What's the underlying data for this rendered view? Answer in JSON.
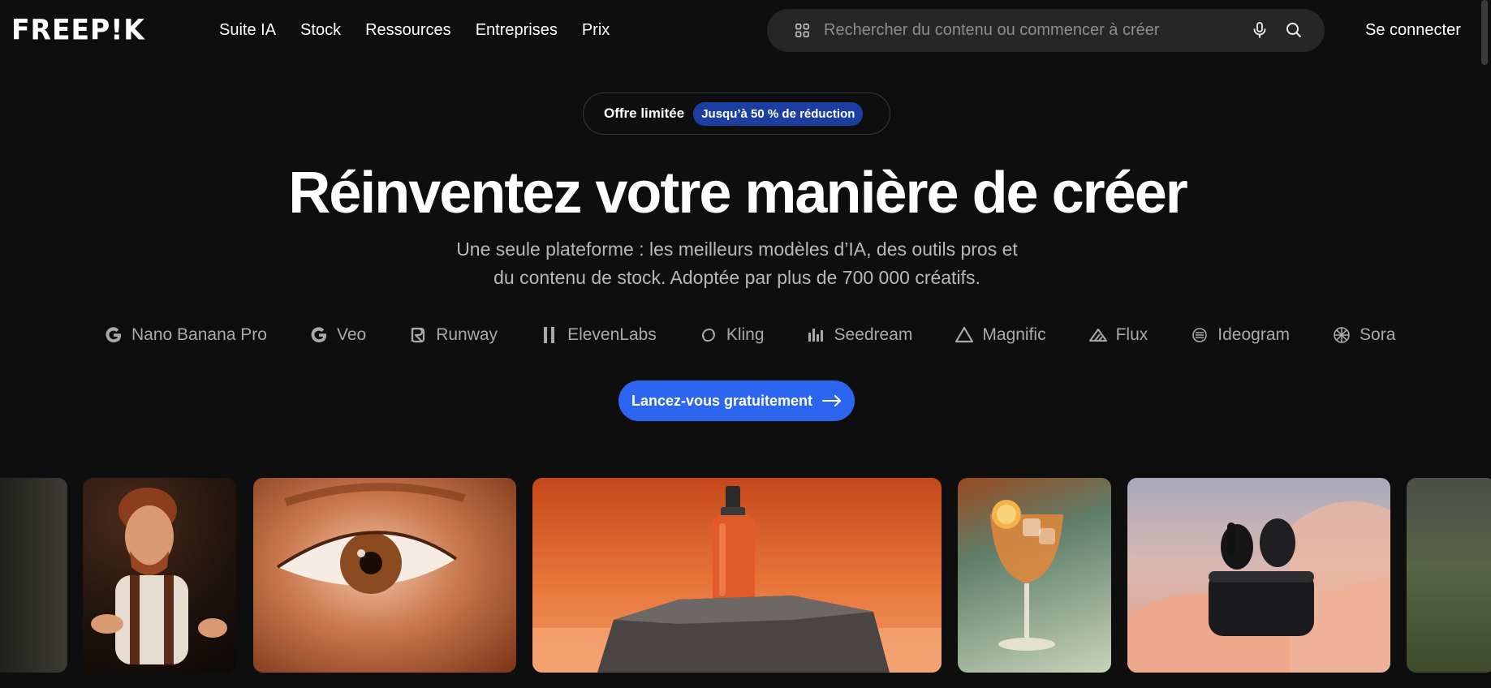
{
  "header": {
    "logo": "FREEP!K",
    "nav": [
      "Suite IA",
      "Stock",
      "Ressources",
      "Entreprises",
      "Prix"
    ],
    "search_placeholder": "Rechercher du contenu ou commencer à créer",
    "login": "Se connecter"
  },
  "offer": {
    "label": "Offre limitée",
    "badge": "Jusqu’à 50 % de réduction"
  },
  "hero": {
    "title": "Réinventez votre manière de créer",
    "subtitle_line1": "Une seule plateforme : les meilleurs modèles d’IA, des outils pros et",
    "subtitle_line2": "du contenu de stock. Adoptée par plus de 700 000 créatifs."
  },
  "models": [
    {
      "name": "Nano Banana Pro",
      "icon": "google-g-icon"
    },
    {
      "name": "Veo",
      "icon": "google-g-icon"
    },
    {
      "name": "Runway",
      "icon": "runway-icon"
    },
    {
      "name": "ElevenLabs",
      "icon": "elevenlabs-icon"
    },
    {
      "name": "Kling",
      "icon": "kling-icon"
    },
    {
      "name": "Seedream",
      "icon": "seedream-icon"
    },
    {
      "name": "Magnific",
      "icon": "magnific-icon"
    },
    {
      "name": "Flux",
      "icon": "flux-icon"
    },
    {
      "name": "Ideogram",
      "icon": "ideogram-icon"
    },
    {
      "name": "Sora",
      "icon": "sora-icon"
    }
  ],
  "cta": {
    "label": "Lancez-vous gratuitement"
  },
  "gallery": [
    "partial-dark-image",
    "cartoon-character",
    "eye-closeup",
    "orange-bottle-on-rock",
    "cocktail-glass",
    "black-earbuds-case",
    "partial-field-image"
  ],
  "colors": {
    "background": "#0e0e0e",
    "accent": "#2c66f0",
    "badge": "#1c3ea0",
    "search_bg": "#262626"
  }
}
